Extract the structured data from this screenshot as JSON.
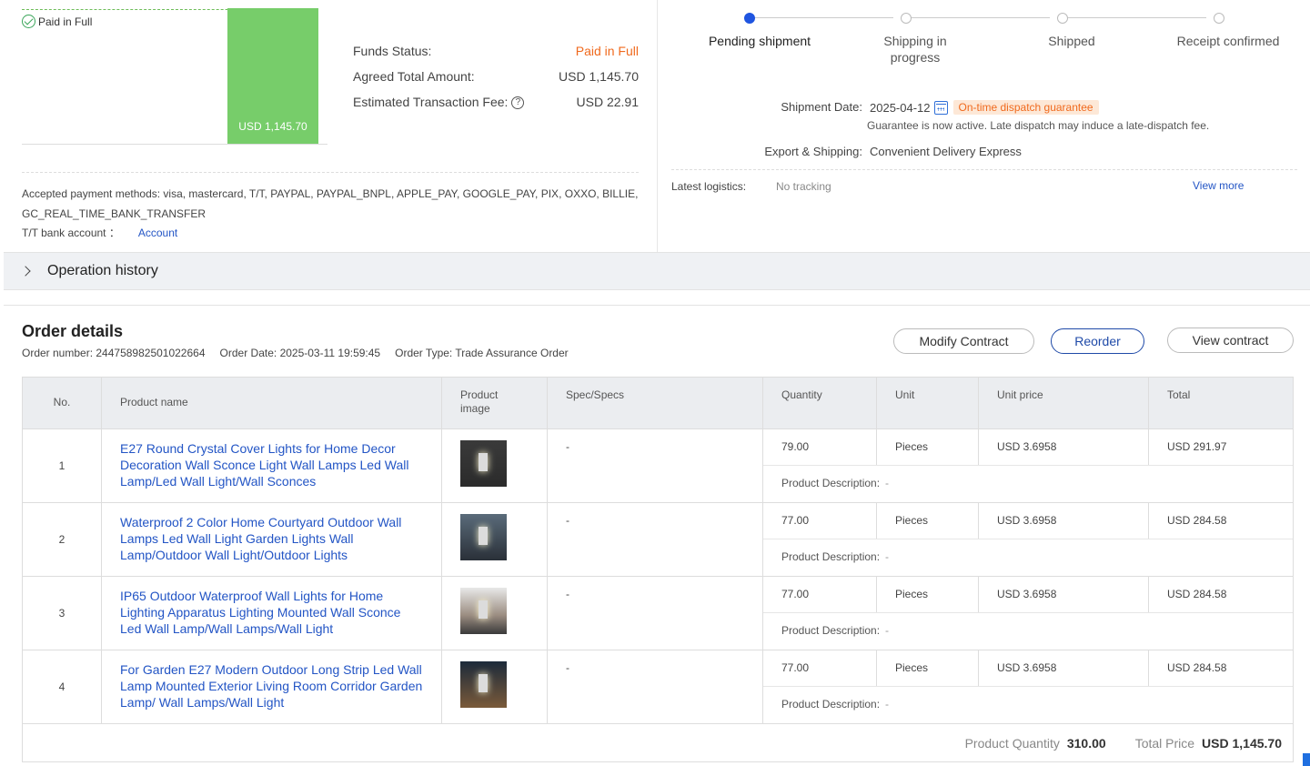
{
  "funds": {
    "badge": "Paid in Full",
    "bar_label": "USD 1,145.70",
    "bar_fraction": 1.0,
    "rows": [
      {
        "label": "Funds Status:",
        "value": "Paid in Full",
        "highlight": true
      },
      {
        "label": "Agreed Total Amount:",
        "value": "USD 1,145.70",
        "highlight": false
      },
      {
        "label": "Estimated Transaction Fee:",
        "value": "USD 22.91",
        "highlight": false,
        "help": "?"
      }
    ],
    "payment_methods": "Accepted payment methods: visa, mastercard, T/T, PAYPAL, PAYPAL_BNPL, APPLE_PAY, GOOGLE_PAY, PIX, OXXO, BILLIE, GC_REAL_TIME_BANK_TRANSFER",
    "tt_label": "T/T bank account ：",
    "tt_link": "Account"
  },
  "shipment": {
    "steps": [
      {
        "label": "Pending shipment",
        "active": true
      },
      {
        "label": "Shipping in progress",
        "active": false
      },
      {
        "label": "Shipped",
        "active": false
      },
      {
        "label": "Receipt confirmed",
        "active": false
      }
    ],
    "date_label": "Shipment Date:",
    "date_value": "2025-04-12",
    "guarantee_tag": "On-time dispatch guarantee",
    "guarantee_note": "Guarantee is now active. Late dispatch may induce a late-dispatch fee.",
    "export_label": "Export & Shipping:",
    "export_value": "Convenient Delivery Express",
    "logistics_label": "Latest logistics:",
    "logistics_value": "No tracking",
    "view_more": "View more"
  },
  "operation_history": {
    "title": "Operation history"
  },
  "order": {
    "title": "Order details",
    "number_label": "Order number:",
    "number_value": "244758982501022664",
    "date_label": "Order Date:",
    "date_value": "2025-03-11 19:59:45",
    "type_label": "Order Type:",
    "type_value": "Trade Assurance Order",
    "buttons": {
      "modify": "Modify Contract",
      "reorder": "Reorder",
      "view": "View contract"
    },
    "columns": {
      "no": "No.",
      "name": "Product name",
      "image": "Product image",
      "spec": "Spec/Specs",
      "qty": "Quantity",
      "unit": "Unit",
      "price": "Unit price",
      "total": "Total"
    },
    "desc_label": "Product Description:",
    "items": [
      {
        "no": "1",
        "name": "E27 Round Crystal Cover Lights for Home Decor Decoration Wall Sconce Light Wall Lamps Led Wall Lamp/Led Wall Light/Wall Sconces",
        "spec": "-",
        "qty": "79.00",
        "unit": "Pieces",
        "price": "USD 3.6958",
        "total": "USD 291.97",
        "desc": "-"
      },
      {
        "no": "2",
        "name": "Waterproof 2 Color Home Courtyard Outdoor Wall Lamps Led Wall Light Garden Lights Wall Lamp/Outdoor Wall Light/Outdoor Lights",
        "spec": "-",
        "qty": "77.00",
        "unit": "Pieces",
        "price": "USD 3.6958",
        "total": "USD 284.58",
        "desc": "-"
      },
      {
        "no": "3",
        "name": "IP65 Outdoor Waterproof Wall Lights for Home Lighting Apparatus Lighting Mounted Wall Sconce Led Wall Lamp/Wall Lamps/Wall Light",
        "spec": "-",
        "qty": "77.00",
        "unit": "Pieces",
        "price": "USD 3.6958",
        "total": "USD 284.58",
        "desc": "-"
      },
      {
        "no": "4",
        "name": "For Garden E27 Modern Outdoor Long Strip Led Wall Lamp Mounted Exterior Living Room Corridor Garden Lamp/ Wall Lamps/Wall Light",
        "spec": "-",
        "qty": "77.00",
        "unit": "Pieces",
        "price": "USD 3.6958",
        "total": "USD 284.58",
        "desc": "-"
      }
    ],
    "footer": {
      "qty_label": "Product Quantity",
      "qty_value": "310.00",
      "price_label": "Total Price",
      "price_value": "USD 1,145.70"
    }
  },
  "colors": {
    "accent": "#1f55e0",
    "paid": "#77cd6a",
    "orange": "#f06a1e",
    "link": "#2355c5"
  }
}
